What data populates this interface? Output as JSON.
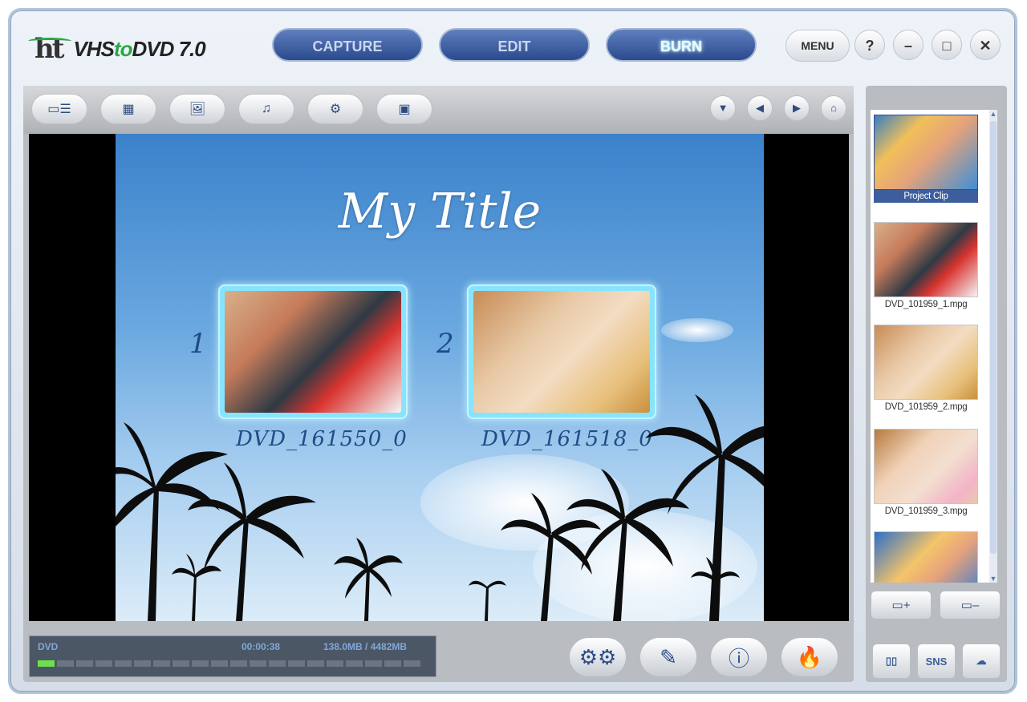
{
  "app": {
    "logo_mark": "ht",
    "logo_brand_pre": "VHS",
    "logo_brand_mid": "to",
    "logo_brand_post": "DVD 7.0"
  },
  "nav": {
    "capture": "CAPTURE",
    "edit": "EDIT",
    "burn": "BURN",
    "active": "burn"
  },
  "window_controls": {
    "menu": "MENU",
    "help": "?",
    "minimize": "–",
    "maximize": "□",
    "close": "✕"
  },
  "toolbar": {
    "tools": [
      {
        "name": "menu-structure-icon",
        "glyph": "▭☰"
      },
      {
        "name": "menu-layout-icon",
        "glyph": "▦"
      },
      {
        "name": "background-image-icon",
        "glyph": "🖼"
      },
      {
        "name": "music-icon",
        "glyph": "♫"
      },
      {
        "name": "menu-settings-icon",
        "glyph": "⚙"
      },
      {
        "name": "preview-icon",
        "glyph": "▣"
      }
    ],
    "nav_down": "▼",
    "nav_prev": "◀",
    "nav_next": "▶",
    "nav_home": "⌂"
  },
  "menu_preview": {
    "title": "My Title",
    "chapters": [
      {
        "number": "1",
        "caption": "DVD_161550_0"
      },
      {
        "number": "2",
        "caption": "DVD_161518_0"
      }
    ]
  },
  "status": {
    "disc_type": "DVD",
    "duration": "00:00:38",
    "size": "138.0MB / 4482MB",
    "used_fraction": 0.031
  },
  "actions": {
    "settings_label": "settings",
    "burn_label": "burn"
  },
  "clips": [
    {
      "name": "Project Clip",
      "selected": true
    },
    {
      "name": "DVD_101959_1.mpg",
      "selected": false
    },
    {
      "name": "DVD_101959_2.mpg",
      "selected": false
    },
    {
      "name": "DVD_101959_3.mpg",
      "selected": false
    },
    {
      "name": "",
      "selected": false
    }
  ],
  "side_buttons": {
    "add": "▭+",
    "remove": "▭–",
    "sns": "SNS"
  },
  "colors": {
    "nav_button": "#2b4a8e",
    "accent_green": "#2aa845",
    "sky_top": "#3b82cb"
  }
}
